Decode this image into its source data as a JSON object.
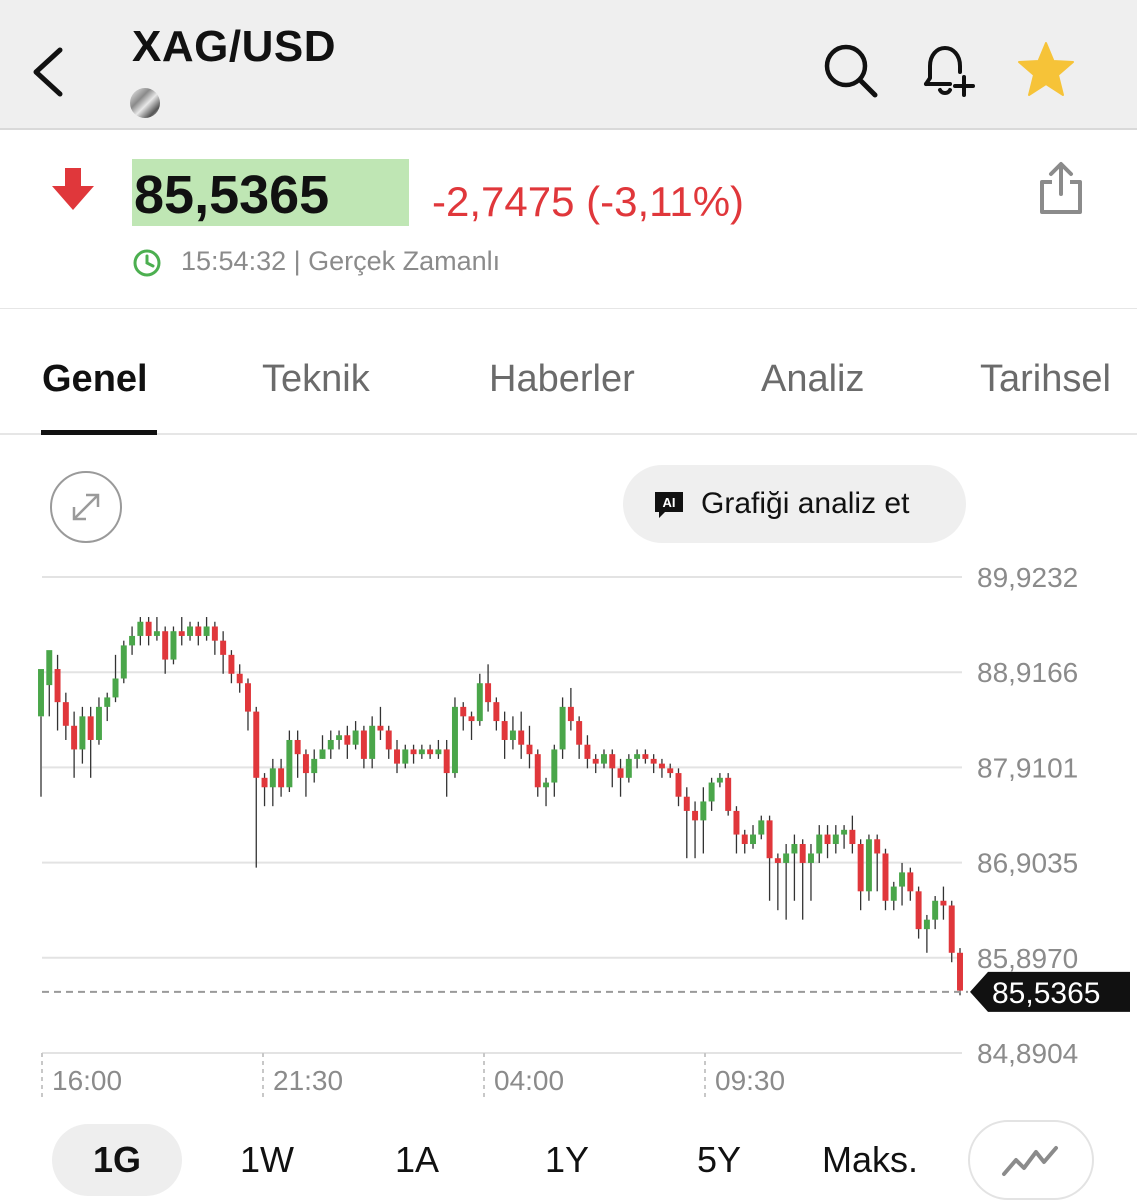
{
  "header": {
    "title": "XAG/USD",
    "icons": {
      "back": "chevron-left-icon",
      "search": "search-icon",
      "alert": "bell-plus-icon",
      "favorite": "star-icon"
    },
    "favorite_color": "#f6c338"
  },
  "quote": {
    "price": "85,5365",
    "change": "-2,7475 (-3,11%)",
    "time": "15:54:32 | Gerçek Zamanlı",
    "direction": "down",
    "colors": {
      "down": "#e0373b",
      "price_highlight": "#bfe6b4",
      "clock": "#4caf50"
    }
  },
  "tabs": [
    {
      "label": "Genel",
      "active": true
    },
    {
      "label": "Teknik",
      "active": false
    },
    {
      "label": "Haberler",
      "active": false
    },
    {
      "label": "Analiz",
      "active": false
    },
    {
      "label": "Tarihsel",
      "active": false
    }
  ],
  "toolbar": {
    "ai_button": "Grafiği analiz et",
    "ai_badge": "AI"
  },
  "chart_data": {
    "type": "candlestick",
    "y_ticks": [
      "89,9232",
      "88,9166",
      "87,9101",
      "86,9035",
      "85,8970",
      "84,8904"
    ],
    "x_ticks": [
      "16:00",
      "21:30",
      "04:00",
      "09:30"
    ],
    "ylim": [
      84.8904,
      89.9232
    ],
    "last_price_label": "85,5365",
    "last_price": 85.5365,
    "colors": {
      "up": "#4aa64a",
      "down": "#e0373b",
      "grid": "#e3e3e3"
    },
    "candles": [
      [
        88.45,
        88.95,
        88.45,
        87.6
      ],
      [
        88.78,
        89.15,
        88.95,
        88.45
      ],
      [
        88.95,
        88.6,
        89.1,
        88.3
      ],
      [
        88.6,
        88.35,
        88.7,
        88.2
      ],
      [
        88.35,
        88.1,
        88.5,
        87.8
      ],
      [
        88.1,
        88.45,
        88.55,
        87.95
      ],
      [
        88.45,
        88.2,
        88.55,
        87.8
      ],
      [
        88.2,
        88.55,
        88.65,
        88.15
      ],
      [
        88.55,
        88.65,
        88.7,
        88.4
      ],
      [
        88.65,
        88.85,
        89.1,
        88.6
      ],
      [
        88.85,
        89.2,
        89.25,
        88.8
      ],
      [
        89.2,
        89.3,
        89.4,
        89.1
      ],
      [
        89.3,
        89.45,
        89.5,
        89.2
      ],
      [
        89.45,
        89.3,
        89.5,
        89.2
      ],
      [
        89.3,
        89.35,
        89.5,
        89.25
      ],
      [
        89.35,
        89.05,
        89.4,
        88.9
      ],
      [
        89.05,
        89.35,
        89.4,
        89.0
      ],
      [
        89.35,
        89.3,
        89.5,
        89.2
      ],
      [
        89.3,
        89.4,
        89.45,
        89.25
      ],
      [
        89.4,
        89.3,
        89.45,
        89.2
      ],
      [
        89.3,
        89.4,
        89.5,
        89.25
      ],
      [
        89.4,
        89.25,
        89.45,
        89.1
      ],
      [
        89.25,
        89.1,
        89.35,
        88.9
      ],
      [
        89.1,
        88.9,
        89.15,
        88.8
      ],
      [
        88.9,
        88.8,
        89.0,
        88.7
      ],
      [
        88.8,
        88.5,
        88.85,
        88.3
      ],
      [
        88.5,
        87.8,
        88.55,
        86.85
      ],
      [
        87.8,
        87.7,
        87.85,
        87.5
      ],
      [
        87.7,
        87.9,
        88.0,
        87.5
      ],
      [
        87.9,
        87.7,
        88.0,
        87.6
      ],
      [
        87.7,
        88.2,
        88.3,
        87.65
      ],
      [
        88.2,
        88.05,
        88.3,
        87.8
      ],
      [
        88.05,
        87.85,
        88.1,
        87.6
      ],
      [
        87.85,
        88.0,
        88.1,
        87.75
      ],
      [
        88.0,
        88.1,
        88.25,
        88.0
      ],
      [
        88.1,
        88.2,
        88.3,
        88.0
      ],
      [
        88.2,
        88.25,
        88.3,
        88.1
      ],
      [
        88.25,
        88.15,
        88.35,
        88.0
      ],
      [
        88.15,
        88.3,
        88.4,
        88.1
      ],
      [
        88.3,
        88.0,
        88.35,
        87.9
      ],
      [
        88.0,
        88.35,
        88.45,
        87.9
      ],
      [
        88.35,
        88.3,
        88.55,
        88.2
      ],
      [
        88.3,
        88.1,
        88.35,
        88.0
      ],
      [
        88.1,
        87.95,
        88.2,
        87.85
      ],
      [
        87.95,
        88.1,
        88.15,
        87.9
      ],
      [
        88.1,
        88.05,
        88.15,
        87.95
      ],
      [
        88.05,
        88.1,
        88.15,
        88.0
      ],
      [
        88.1,
        88.05,
        88.15,
        88.0
      ],
      [
        88.05,
        88.1,
        88.2,
        88.0
      ],
      [
        88.1,
        87.85,
        88.2,
        87.6
      ],
      [
        87.85,
        88.55,
        88.65,
        87.8
      ],
      [
        88.55,
        88.45,
        88.6,
        88.3
      ],
      [
        88.45,
        88.4,
        88.5,
        88.2
      ],
      [
        88.4,
        88.8,
        88.9,
        88.35
      ],
      [
        88.8,
        88.6,
        89.0,
        88.5
      ],
      [
        88.6,
        88.4,
        88.65,
        88.3
      ],
      [
        88.4,
        88.2,
        88.5,
        88.0
      ],
      [
        88.2,
        88.3,
        88.45,
        88.1
      ],
      [
        88.3,
        88.15,
        88.5,
        88.0
      ],
      [
        88.15,
        88.05,
        88.35,
        87.9
      ],
      [
        88.05,
        87.7,
        88.1,
        87.6
      ],
      [
        87.7,
        87.75,
        87.8,
        87.5
      ],
      [
        87.75,
        88.1,
        88.15,
        87.6
      ],
      [
        88.1,
        88.55,
        88.65,
        88.0
      ],
      [
        88.55,
        88.4,
        88.75,
        88.3
      ],
      [
        88.4,
        88.15,
        88.45,
        88.0
      ],
      [
        88.15,
        88.0,
        88.25,
        87.9
      ],
      [
        88.0,
        87.95,
        88.05,
        87.85
      ],
      [
        87.95,
        88.05,
        88.1,
        87.9
      ],
      [
        88.05,
        87.9,
        88.1,
        87.7
      ],
      [
        87.9,
        87.8,
        88.0,
        87.6
      ],
      [
        87.8,
        88.0,
        88.05,
        87.75
      ],
      [
        88.0,
        88.05,
        88.1,
        87.9
      ],
      [
        88.05,
        88.0,
        88.1,
        87.95
      ],
      [
        88.0,
        87.95,
        88.05,
        87.85
      ],
      [
        87.95,
        87.9,
        88.0,
        87.8
      ],
      [
        87.9,
        87.85,
        87.95,
        87.8
      ],
      [
        87.85,
        87.6,
        87.9,
        87.5
      ],
      [
        87.6,
        87.45,
        87.7,
        86.95
      ],
      [
        87.45,
        87.35,
        87.55,
        86.95
      ],
      [
        87.35,
        87.55,
        87.7,
        87.0
      ],
      [
        87.55,
        87.75,
        87.8,
        87.45
      ],
      [
        87.75,
        87.8,
        87.85,
        87.7
      ],
      [
        87.8,
        87.45,
        87.85,
        87.4
      ],
      [
        87.45,
        87.2,
        87.5,
        87.0
      ],
      [
        87.2,
        87.1,
        87.25,
        87.0
      ],
      [
        87.1,
        87.2,
        87.3,
        87.05
      ],
      [
        87.2,
        87.35,
        87.4,
        87.15
      ],
      [
        87.35,
        86.95,
        87.4,
        86.5
      ],
      [
        86.95,
        86.9,
        87.0,
        86.4
      ],
      [
        86.9,
        87.0,
        87.1,
        86.3
      ],
      [
        87.0,
        87.1,
        87.2,
        86.5
      ],
      [
        87.1,
        86.9,
        87.15,
        86.3
      ],
      [
        86.9,
        87.0,
        87.1,
        86.5
      ],
      [
        87.0,
        87.2,
        87.3,
        86.9
      ],
      [
        87.2,
        87.1,
        87.3,
        86.95
      ],
      [
        87.1,
        87.2,
        87.3,
        87.0
      ],
      [
        87.2,
        87.25,
        87.3,
        87.05
      ],
      [
        87.25,
        87.1,
        87.4,
        87.0
      ],
      [
        87.1,
        86.6,
        87.15,
        86.4
      ],
      [
        86.6,
        87.15,
        87.2,
        86.5
      ],
      [
        87.15,
        87.0,
        87.2,
        86.6
      ],
      [
        87.0,
        86.5,
        87.05,
        86.4
      ],
      [
        86.5,
        86.65,
        86.7,
        86.4
      ],
      [
        86.65,
        86.8,
        86.9,
        86.45
      ],
      [
        86.8,
        86.6,
        86.85,
        86.5
      ],
      [
        86.6,
        86.2,
        86.65,
        86.1
      ],
      [
        86.2,
        86.3,
        86.35,
        85.95
      ],
      [
        86.3,
        86.5,
        86.55,
        86.2
      ],
      [
        86.5,
        86.45,
        86.65,
        86.3
      ],
      [
        86.45,
        85.95,
        86.5,
        85.85
      ],
      [
        85.95,
        85.55,
        86.0,
        85.5
      ]
    ]
  },
  "ranges": [
    {
      "label": "1G",
      "active": true
    },
    {
      "label": "1W",
      "active": false
    },
    {
      "label": "1A",
      "active": false
    },
    {
      "label": "1Y",
      "active": false
    },
    {
      "label": "5Y",
      "active": false
    },
    {
      "label": "Maks.",
      "active": false
    }
  ]
}
